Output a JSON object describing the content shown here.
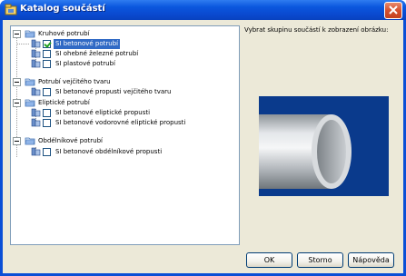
{
  "window": {
    "title": "Katalog součástí"
  },
  "prompt": "Vybrat skupinu součástí k zobrazení obrázku:",
  "tree": {
    "groups": [
      {
        "label": "Kruhové potrubí",
        "items": [
          {
            "label": "SI betonové potrubí",
            "checked": true,
            "selected": true
          },
          {
            "label": "SI ohebné železné potrubí",
            "checked": false,
            "selected": false
          },
          {
            "label": "SI plastové potrubí",
            "checked": false,
            "selected": false
          }
        ]
      },
      {
        "label": "Potrubí vejčitého tvaru",
        "items": [
          {
            "label": "SI betonové propusti vejčitého tvaru",
            "checked": false,
            "selected": false
          }
        ]
      },
      {
        "label": "Eliptické potrubí",
        "items": [
          {
            "label": "SI betonové eliptické propusti",
            "checked": false,
            "selected": false
          },
          {
            "label": "SI betonové vodorovné eliptické propusti",
            "checked": false,
            "selected": false
          }
        ]
      },
      {
        "label": "Obdélníkové potrubí",
        "items": [
          {
            "label": "SI betonové obdélníkové propusti",
            "checked": false,
            "selected": false
          }
        ]
      }
    ]
  },
  "buttons": {
    "ok": "OK",
    "cancel": "Storno",
    "help": "Nápověda"
  },
  "colors": {
    "titlebar": "#0b57de",
    "dialog_bg": "#ece9d8",
    "preview_bg": "#0a3a8c",
    "selection": "#316ac5"
  },
  "icons": {
    "title": "catalog-icon",
    "group": "folder-icon",
    "item": "part-icon"
  }
}
